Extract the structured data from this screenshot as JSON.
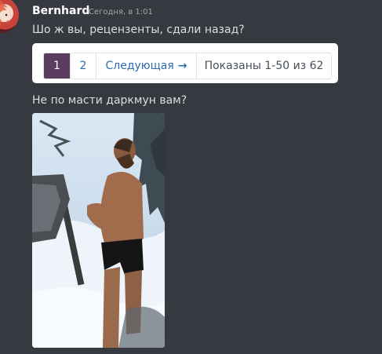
{
  "message": {
    "author": "Bernhard",
    "timestamp": "Сегодня, в 1:01",
    "line1": "Шо ж вы, рецензенты, сдали назад?",
    "line2": "Не по масти даркмун вам?"
  },
  "pagination": {
    "page1": "1",
    "page2": "2",
    "next_label": "Следующая",
    "next_arrow": "→",
    "shown_text": "Показаны 1-50 из 62"
  },
  "colors": {
    "background": "#36393f",
    "active_page": "#5b3d60",
    "link": "#2b6cb0"
  }
}
